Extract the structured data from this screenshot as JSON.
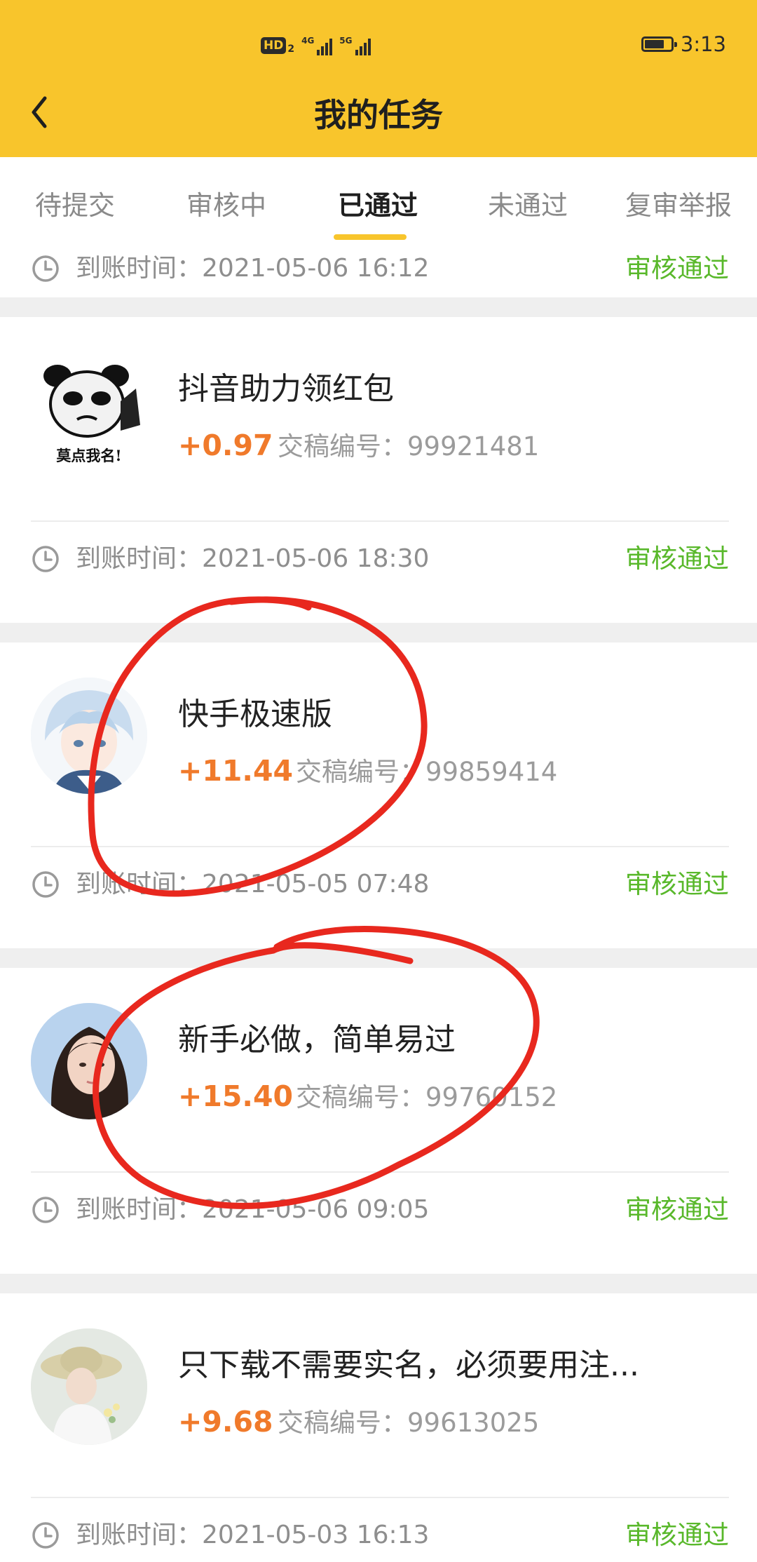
{
  "status_bar": {
    "hd_label": "HD",
    "hd_sub": "2",
    "sim1_label": "4G",
    "sim2_label": "5G",
    "battery_level": 0.75,
    "time": "3:13"
  },
  "header": {
    "title": "我的任务"
  },
  "tabs": [
    {
      "label": "待提交",
      "active": false
    },
    {
      "label": "审核中",
      "active": false
    },
    {
      "label": "已通过",
      "active": true
    },
    {
      "label": "未通过",
      "active": false
    },
    {
      "label": "复审举报",
      "active": false
    }
  ],
  "partial_card": {
    "arrive_label": "到账时间：",
    "arrive_time": "2021-05-06 16:12",
    "status": "审核通过"
  },
  "tasks": [
    {
      "title": "抖音助力领红包",
      "reward": "+0.97",
      "submission_label": "交稿编号：",
      "submission_no": "99921481",
      "arrive_label": "到账时间：",
      "arrive_time": "2021-05-06 18:30",
      "status": "审核通过",
      "avatar_caption": "莫点我名!"
    },
    {
      "title": "快手极速版",
      "reward": "+11.44",
      "submission_label": "交稿编号：",
      "submission_no": "99859414",
      "arrive_label": "到账时间：",
      "arrive_time": "2021-05-05 07:48",
      "status": "审核通过"
    },
    {
      "title": "新手必做，简单易过",
      "reward": "+15.40",
      "submission_label": "交稿编号：",
      "submission_no": "99760152",
      "arrive_label": "到账时间：",
      "arrive_time": "2021-05-06 09:05",
      "status": "审核通过"
    },
    {
      "title": "只下载不需要实名，必须要用注...",
      "reward": "+9.68",
      "submission_label": "交稿编号：",
      "submission_no": "99613025",
      "arrive_label": "到账时间：",
      "arrive_time": "2021-05-03 16:13",
      "status": "审核通过"
    }
  ],
  "colors": {
    "header_bg": "#f8c52c",
    "reward": "#f07a2b",
    "status_pass": "#59b82b",
    "annotation": "#e8281e"
  }
}
